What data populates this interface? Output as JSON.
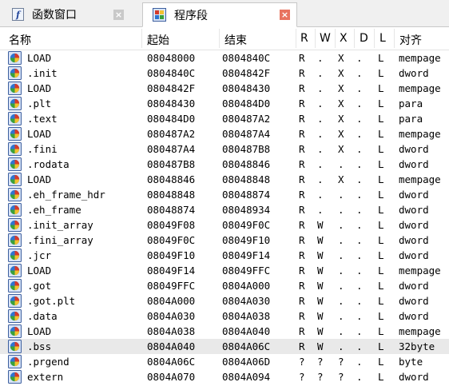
{
  "tabs": [
    {
      "label": "函数窗口",
      "icon": "function-icon",
      "active": false,
      "close": "×"
    },
    {
      "label": "程序段",
      "icon": "segment-icon",
      "active": true,
      "close": "×"
    }
  ],
  "columns": {
    "name": "名称",
    "start": "起始",
    "end": "结束",
    "r": "R",
    "w": "W",
    "x": "X",
    "d": "D",
    "l": "L",
    "align": "对齐"
  },
  "rows": [
    {
      "name": "LOAD",
      "start": "08048000",
      "end": "0804840C",
      "r": "R",
      "w": ".",
      "x": "X",
      "d": ".",
      "l": "L",
      "align": "mempage"
    },
    {
      "name": ".init",
      "start": "0804840C",
      "end": "0804842F",
      "r": "R",
      "w": ".",
      "x": "X",
      "d": ".",
      "l": "L",
      "align": "dword"
    },
    {
      "name": "LOAD",
      "start": "0804842F",
      "end": "08048430",
      "r": "R",
      "w": ".",
      "x": "X",
      "d": ".",
      "l": "L",
      "align": "mempage"
    },
    {
      "name": ".plt",
      "start": "08048430",
      "end": "080484D0",
      "r": "R",
      "w": ".",
      "x": "X",
      "d": ".",
      "l": "L",
      "align": "para"
    },
    {
      "name": ".text",
      "start": "080484D0",
      "end": "080487A2",
      "r": "R",
      "w": ".",
      "x": "X",
      "d": ".",
      "l": "L",
      "align": "para"
    },
    {
      "name": "LOAD",
      "start": "080487A2",
      "end": "080487A4",
      "r": "R",
      "w": ".",
      "x": "X",
      "d": ".",
      "l": "L",
      "align": "mempage"
    },
    {
      "name": ".fini",
      "start": "080487A4",
      "end": "080487B8",
      "r": "R",
      "w": ".",
      "x": "X",
      "d": ".",
      "l": "L",
      "align": "dword"
    },
    {
      "name": ".rodata",
      "start": "080487B8",
      "end": "08048846",
      "r": "R",
      "w": ".",
      "x": ".",
      "d": ".",
      "l": "L",
      "align": "dword"
    },
    {
      "name": "LOAD",
      "start": "08048846",
      "end": "08048848",
      "r": "R",
      "w": ".",
      "x": "X",
      "d": ".",
      "l": "L",
      "align": "mempage"
    },
    {
      "name": ".eh_frame_hdr",
      "start": "08048848",
      "end": "08048874",
      "r": "R",
      "w": ".",
      "x": ".",
      "d": ".",
      "l": "L",
      "align": "dword"
    },
    {
      "name": ".eh_frame",
      "start": "08048874",
      "end": "08048934",
      "r": "R",
      "w": ".",
      "x": ".",
      "d": ".",
      "l": "L",
      "align": "dword"
    },
    {
      "name": ".init_array",
      "start": "08049F08",
      "end": "08049F0C",
      "r": "R",
      "w": "W",
      "x": ".",
      "d": ".",
      "l": "L",
      "align": "dword"
    },
    {
      "name": ".fini_array",
      "start": "08049F0C",
      "end": "08049F10",
      "r": "R",
      "w": "W",
      "x": ".",
      "d": ".",
      "l": "L",
      "align": "dword"
    },
    {
      "name": ".jcr",
      "start": "08049F10",
      "end": "08049F14",
      "r": "R",
      "w": "W",
      "x": ".",
      "d": ".",
      "l": "L",
      "align": "dword"
    },
    {
      "name": "LOAD",
      "start": "08049F14",
      "end": "08049FFC",
      "r": "R",
      "w": "W",
      "x": ".",
      "d": ".",
      "l": "L",
      "align": "mempage"
    },
    {
      "name": ".got",
      "start": "08049FFC",
      "end": "0804A000",
      "r": "R",
      "w": "W",
      "x": ".",
      "d": ".",
      "l": "L",
      "align": "dword"
    },
    {
      "name": ".got.plt",
      "start": "0804A000",
      "end": "0804A030",
      "r": "R",
      "w": "W",
      "x": ".",
      "d": ".",
      "l": "L",
      "align": "dword"
    },
    {
      "name": ".data",
      "start": "0804A030",
      "end": "0804A038",
      "r": "R",
      "w": "W",
      "x": ".",
      "d": ".",
      "l": "L",
      "align": "dword"
    },
    {
      "name": "LOAD",
      "start": "0804A038",
      "end": "0804A040",
      "r": "R",
      "w": "W",
      "x": ".",
      "d": ".",
      "l": "L",
      "align": "mempage"
    },
    {
      "name": ".bss",
      "start": "0804A040",
      "end": "0804A06C",
      "r": "R",
      "w": "W",
      "x": ".",
      "d": ".",
      "l": "L",
      "align": "32byte",
      "selected": true
    },
    {
      "name": ".prgend",
      "start": "0804A06C",
      "end": "0804A06D",
      "r": "?",
      "w": "?",
      "x": "?",
      "d": ".",
      "l": "L",
      "align": "byte"
    },
    {
      "name": "extern",
      "start": "0804A070",
      "end": "0804A094",
      "r": "?",
      "w": "?",
      "x": "?",
      "d": ".",
      "l": "L",
      "align": "dword"
    }
  ],
  "colors": {
    "selected_row": "#e9e9e9",
    "active_close": "#e8735f",
    "inactive_close": "#c9c9c9"
  }
}
